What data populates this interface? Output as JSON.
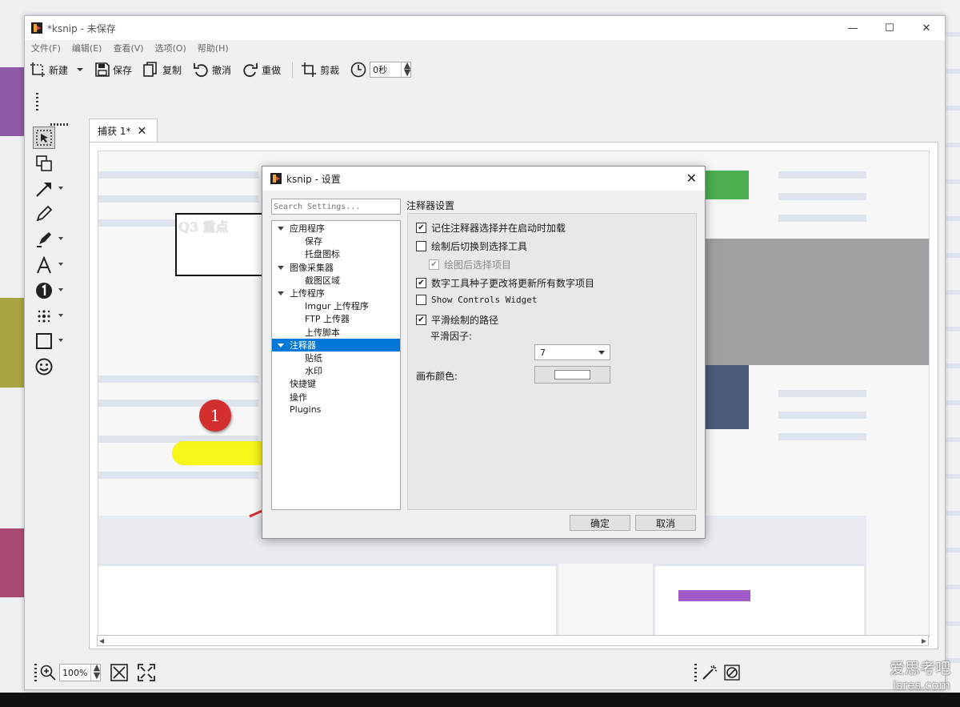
{
  "window": {
    "title": "*ksnip - 未保存"
  },
  "menu": [
    "文件(F)",
    "编辑(E)",
    "查看(V)",
    "选项(O)",
    "帮助(H)"
  ],
  "toolbar": {
    "new_label": "新建",
    "save_label": "保存",
    "copy_label": "复制",
    "undo_label": "撤消",
    "redo_label": "重做",
    "crop_label": "剪裁",
    "delay_value": "0秒"
  },
  "tab": {
    "label": "捕获 1*"
  },
  "canvas": {
    "text_box": "Q3 重点",
    "number_marker": "1"
  },
  "zoom": {
    "value": "100%"
  },
  "dialog": {
    "title": "ksnip - 设置",
    "search_placeholder": "Search Settings...",
    "tree": [
      {
        "label": "应用程序",
        "level": 0,
        "expanded": true
      },
      {
        "label": "保存",
        "level": 1
      },
      {
        "label": "托盘图标",
        "level": 1
      },
      {
        "label": "图像采集器",
        "level": 0,
        "expanded": true
      },
      {
        "label": "截图区域",
        "level": 1
      },
      {
        "label": "上传程序",
        "level": 0,
        "expanded": true
      },
      {
        "label": "Imgur 上传程序",
        "level": 1
      },
      {
        "label": "FTP 上传器",
        "level": 1
      },
      {
        "label": "上传脚本",
        "level": 1
      },
      {
        "label": "注释器",
        "level": 0,
        "expanded": true,
        "selected": true
      },
      {
        "label": "贴纸",
        "level": 1
      },
      {
        "label": "水印",
        "level": 1
      },
      {
        "label": "快捷键",
        "level": 0
      },
      {
        "label": "操作",
        "level": 0
      },
      {
        "label": "Plugins",
        "level": 0
      }
    ],
    "panel_title": "注释器设置",
    "options": {
      "remember_tool": {
        "label": "记住注释器选择并在启动时加载",
        "checked": true
      },
      "switch_after_draw": {
        "label": "绘制后切换到选择工具",
        "checked": false
      },
      "select_after_draw": {
        "label": "绘图后选择项目",
        "checked": true,
        "disabled": true
      },
      "number_seed": {
        "label": "数字工具种子更改将更新所有数字项目",
        "checked": true
      },
      "show_controls": {
        "label": "Show Controls Widget",
        "checked": false
      },
      "smooth_path": {
        "label": "平滑绘制的路径",
        "checked": true
      }
    },
    "smooth_factor_label": "平滑因子:",
    "smooth_factor_value": "7",
    "canvas_color_label": "画布颜色:",
    "canvas_color": "#ffffff",
    "ok_label": "确定",
    "cancel_label": "取消"
  },
  "watermark": {
    "line1": "爱思考吧",
    "line2": "isres.com"
  },
  "colors": {
    "selection": "#0078d7",
    "marker_red": "#d32f2f",
    "highlighter": "#f5f500",
    "block_green": "#4caf50",
    "block_gray": "#9e9ea3",
    "block_navy": "#4a5a78",
    "block_purple": "#a15bc7"
  }
}
